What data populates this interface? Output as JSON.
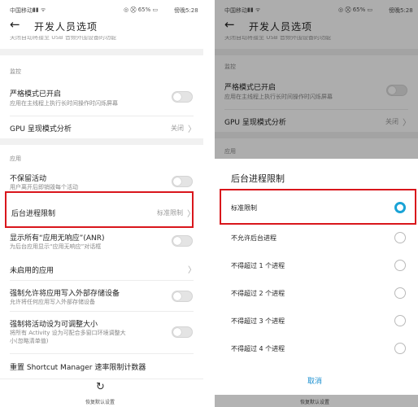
{
  "left": {
    "status": {
      "carrier": "中国移动",
      "icons": "◎ ⛒ 65% ▭",
      "time": "傍晚5:28"
    },
    "appbar": {
      "title": "开发人员选项"
    },
    "cut_text": "关闭自动将接至 USB 音频外围设备的功能",
    "monitor_header": "监控",
    "strict_mode": {
      "title": "严格模式已开启",
      "subtitle": "应用在主线程上执行长时间操作时闪烁屏幕"
    },
    "gpu": {
      "title": "GPU 呈现模式分析",
      "value": "关闭"
    },
    "apps_header": "应用",
    "dont_keep": {
      "title": "不保留活动",
      "subtitle": "用户离开后即销毁每个活动"
    },
    "bg_limit": {
      "title": "后台进程限制",
      "value": "标准限制"
    },
    "anr": {
      "title": "显示所有“应用无响应”(ANR)",
      "subtitle": "为后台应用显示“应用无响应”对话框"
    },
    "inactive": {
      "title": "未启用的应用"
    },
    "force_external": {
      "title": "强制允许将应用写入外部存储设备",
      "subtitle": "允许将任何应用写入外部存储设备"
    },
    "force_resizable": {
      "title": "强制将活动设为可调整大小",
      "subtitle_1": "将所有 Activity 设为可配合多窗口环境调整大",
      "subtitle_2": "小(忽略清单值)"
    },
    "shortcut": {
      "title": "重置 Shortcut Manager 速率限制计数器"
    },
    "restore": {
      "label": "恢复默认设置"
    }
  },
  "right": {
    "status": {
      "carrier": "中国移动",
      "icons": "◎ ⛒ 65% ▭",
      "time": "傍晚5:28"
    },
    "appbar": {
      "title": "开发人员选项"
    },
    "cut_text": "关闭自动将接至 USB 音频外围设备的功能",
    "monitor_header": "监控",
    "strict_mode": {
      "title": "严格模式已开启",
      "subtitle": "应用在主线程上执行长时间操作时闪烁屏幕"
    },
    "gpu": {
      "title": "GPU 呈现模式分析",
      "value": "关闭"
    },
    "apps_header": "应用",
    "dialog": {
      "title": "后台进程限制",
      "options": [
        "标准限制",
        "不允许后台进程",
        "不得超过 1 个进程",
        "不得超过 2 个进程",
        "不得超过 3 个进程",
        "不得超过 4 个进程"
      ],
      "selected": "标准限制",
      "cancel": "取消"
    },
    "restore": {
      "label": "恢复默认设置"
    }
  },
  "colors": {
    "highlight": "#d9161c",
    "radio_selected": "#1aa3d6",
    "cancel": "#1a8fd0"
  },
  "icons": {
    "back": "arrow-left-icon",
    "chevron": "chevron-right-icon",
    "restore": "restore-icon"
  }
}
